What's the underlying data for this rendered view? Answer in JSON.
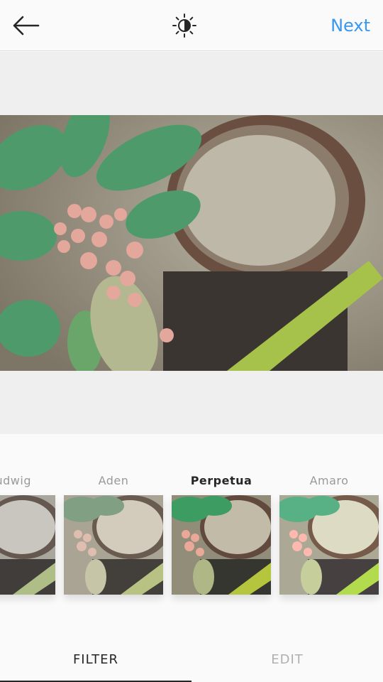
{
  "header": {
    "back_icon": "arrow-left-icon",
    "lux_icon": "sun-adjust-icon",
    "next_label": "Next",
    "accent_color": "#3897f0"
  },
  "filters": [
    {
      "name": "Ludwig",
      "active": false
    },
    {
      "name": "Aden",
      "active": false
    },
    {
      "name": "Perpetua",
      "active": true
    },
    {
      "name": "Amaro",
      "active": false
    }
  ],
  "tabs": {
    "filter_label": "FILTER",
    "edit_label": "EDIT",
    "active": "FILTER"
  }
}
